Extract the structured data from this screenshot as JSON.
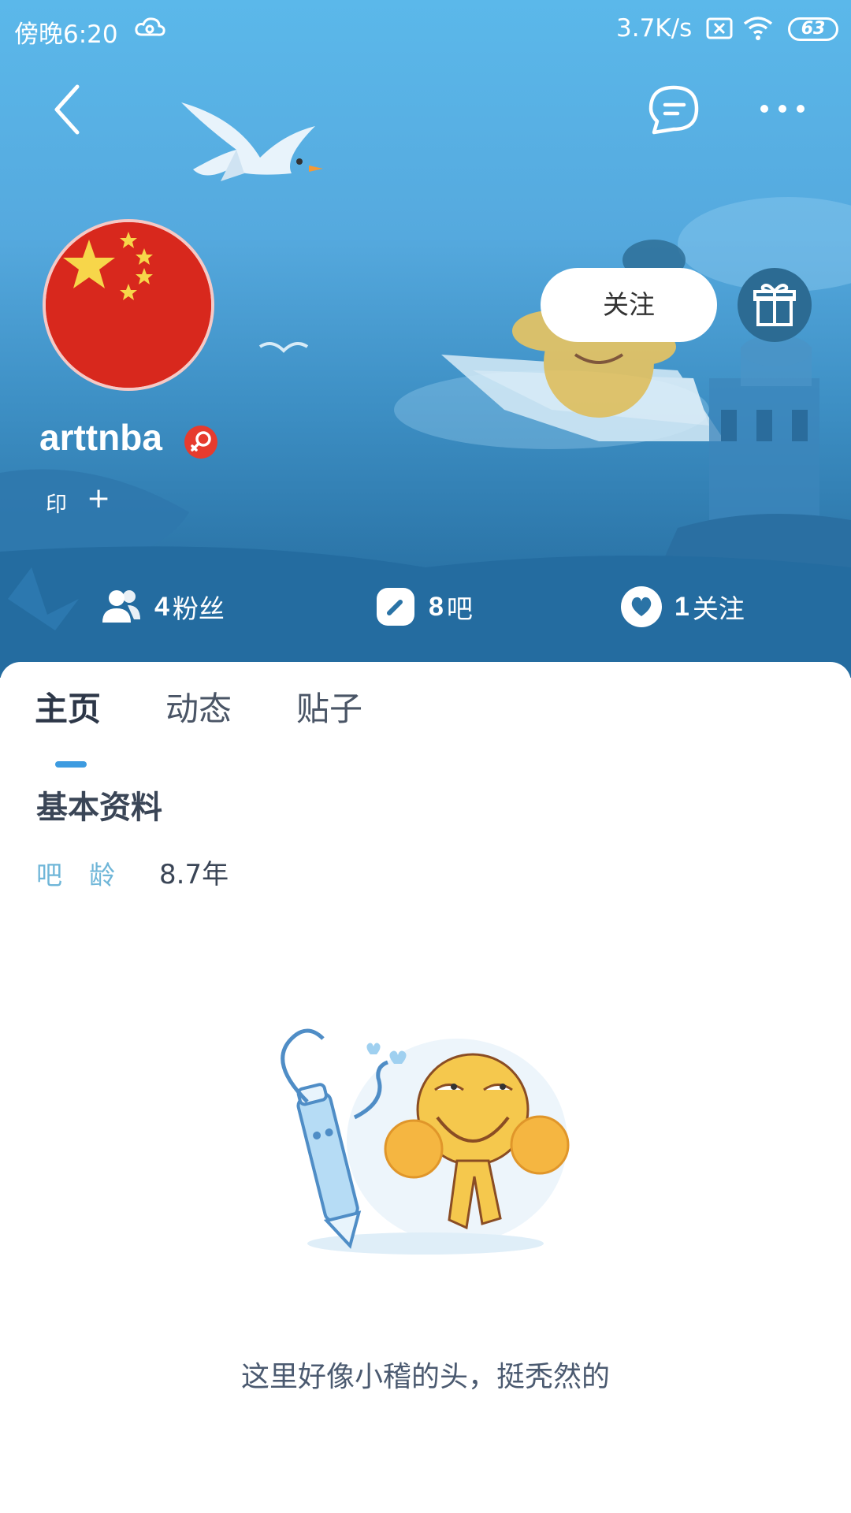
{
  "status_bar": {
    "time": "傍晚6:20",
    "network_speed": "3.7K/s",
    "battery": "63"
  },
  "header": {
    "back_icon": "chevron-left-icon",
    "message_icon": "chat-bubble-icon",
    "more_icon": "more-dots-icon"
  },
  "profile": {
    "username": "arttnba",
    "gender": "female",
    "badge_text": "印",
    "badge_add": "+",
    "follow_label": "关注",
    "gift_icon": "gift-icon",
    "avatar": "china-flag-avatar"
  },
  "stats": [
    {
      "icon": "fans-icon",
      "count": "4",
      "label": "粉丝"
    },
    {
      "icon": "bar-icon",
      "count": "8",
      "label": "吧"
    },
    {
      "icon": "heart-icon",
      "count": "1",
      "label": "关注"
    }
  ],
  "tabs": [
    {
      "label": "主页",
      "active": true
    },
    {
      "label": "动态",
      "active": false
    },
    {
      "label": "贴子",
      "active": false
    }
  ],
  "basic_info": {
    "title": "基本资料",
    "age_label": "吧龄",
    "age_value": "8.7年"
  },
  "empty_state": {
    "text": "这里好像小稽的头，挺秃然的"
  },
  "colors": {
    "banner_top": "#5bb8ea",
    "banner_bottom": "#1f6596",
    "accent": "#3d9be0",
    "flag_red": "#d8281d",
    "flag_star": "#f7d64a"
  }
}
